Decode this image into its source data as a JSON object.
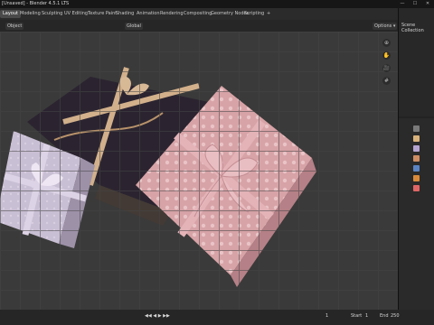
{
  "window": {
    "title": "[Unsaved] - Blender 4.5.1 LTS",
    "controls": [
      "—",
      "☐",
      "✕"
    ]
  },
  "menubar": {
    "workspaces": [
      "Layout",
      "Modeling",
      "Sculpting",
      "UV Editing",
      "Texture Paint",
      "Shading",
      "Animation",
      "Rendering",
      "Compositing",
      "Geometry Nodes",
      "Scripting"
    ],
    "add": "+"
  },
  "viewport_header": {
    "mode": "Object",
    "shading": "Global",
    "options": "Options ▾"
  },
  "timeline": {
    "playback": "◀◀ ◀ ▶ ▶▶",
    "frame": "1",
    "start_label": "Start",
    "start": "1",
    "end_label": "End",
    "end": "250"
  },
  "outliner": {
    "title": "Scene Collection"
  },
  "colors": {
    "accent": "#d98b3a",
    "pink_gift": "#d7a3a7",
    "lavender_gift": "#c9bfd4",
    "dark_gift": "#2b2430",
    "ribbon_tan": "#d2b08b"
  }
}
